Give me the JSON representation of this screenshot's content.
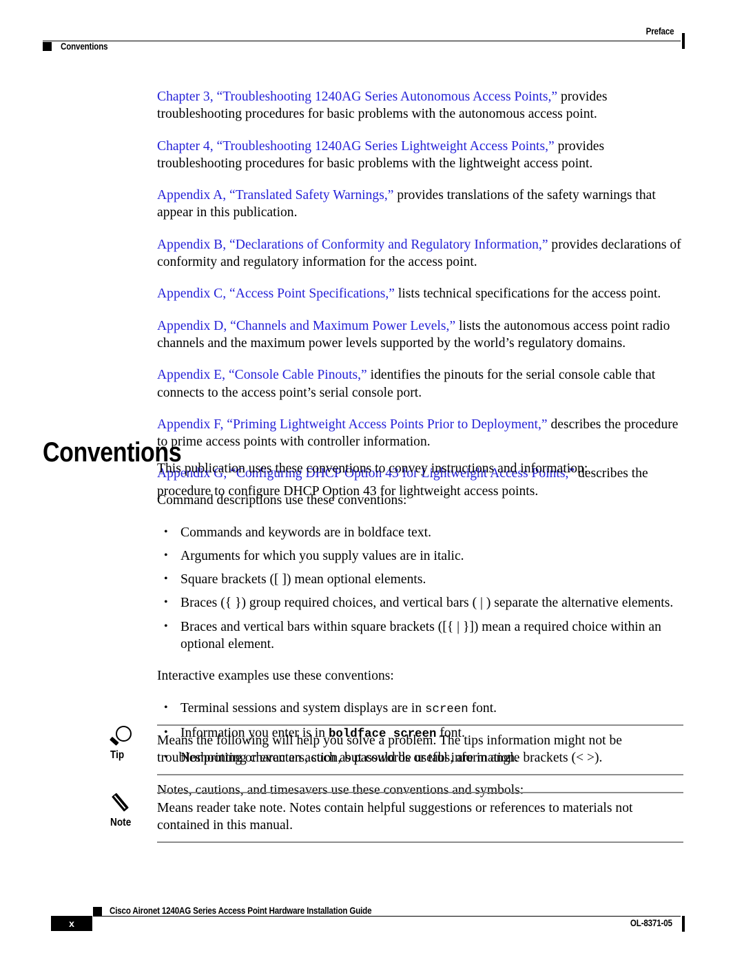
{
  "header": {
    "right_title": "Preface",
    "left_title": "Conventions"
  },
  "intro_paragraphs": [
    {
      "link": "Chapter 3, “Troubleshooting 1240AG Series Autonomous Access Points,”",
      "rest": " provides troubleshooting procedures for basic problems with the autonomous access point."
    },
    {
      "link": "Chapter 4, “Troubleshooting 1240AG Series Lightweight Access Points,”",
      "rest": " provides troubleshooting procedures for basic problems with the lightweight access point."
    },
    {
      "link": "Appendix A, “Translated Safety Warnings,”",
      "rest": " provides translations of the safety warnings that appear in this publication."
    },
    {
      "link": "Appendix B, “Declarations of Conformity and Regulatory Information,”",
      "rest": " provides declarations of conformity and regulatory information for the access point."
    },
    {
      "link": "Appendix C, “Access Point Specifications,”",
      "rest": " lists technical specifications for the access point."
    },
    {
      "link": "Appendix D, “Channels and Maximum Power Levels,”",
      "rest": " lists the autonomous access point radio channels and the maximum power levels supported by the world’s regulatory domains."
    },
    {
      "link": "Appendix E, “Console Cable Pinouts,”",
      "rest": " identifies the pinouts for the serial console cable that connects to the access point’s serial console port."
    },
    {
      "link": "Appendix F, “Priming Lightweight Access Points Prior to Deployment,”",
      "rest": " describes the procedure to prime access points with controller information."
    },
    {
      "link": "Appendix G, “Configuring DHCP Option 43 for Lightweight Access Points,”",
      "rest": " describes the procedure to configure DHCP Option 43 for lightweight access points."
    }
  ],
  "section": {
    "heading": "Conventions",
    "intro_1": "This publication uses these conventions to convey instructions and information:",
    "intro_2": "Command descriptions use these conventions:",
    "command_bullets": [
      "Commands and keywords are in boldface text.",
      "Arguments for which you supply values are in italic.",
      "Square brackets ([ ]) mean optional elements.",
      "Braces ({ }) group required choices, and vertical bars ( | ) separate the alternative elements.",
      "Braces and vertical bars within square brackets ([{ | }]) mean a required choice within an optional element."
    ],
    "intro_3": "Interactive examples use these conventions:",
    "interactive_bullets": [
      {
        "pre": "Terminal sessions and system displays are in ",
        "mono": "screen",
        "mono_bold": "",
        "post": " font."
      },
      {
        "pre": "Information you enter is in ",
        "mono": "",
        "mono_bold": "boldface screen",
        "post": " font."
      },
      {
        "pre": "Nonprinting characters, such as passwords or tabs, are in angle brackets (< >).",
        "mono": "",
        "mono_bold": "",
        "post": ""
      }
    ],
    "intro_4": "Notes, cautions, and timesavers use these conventions and symbols:"
  },
  "admonitions": [
    {
      "label": "Tip",
      "icon": "magnifier-icon",
      "text": "Means the following will help you solve a problem. The tips information might not be troubleshooting or even an action, but could be useful information."
    },
    {
      "label": "Note",
      "icon": "pencil-icon",
      "text": "Means reader take note. Notes contain helpful suggestions or references to materials not contained in this manual."
    }
  ],
  "footer": {
    "page_number": "x",
    "title": "Cisco Aironet 1240AG Series Access Point Hardware Installation Guide",
    "doc_id": "OL-8371-05"
  },
  "colors": {
    "link": "#2622d8",
    "rule": "#8c8c8c",
    "text": "#000000"
  }
}
